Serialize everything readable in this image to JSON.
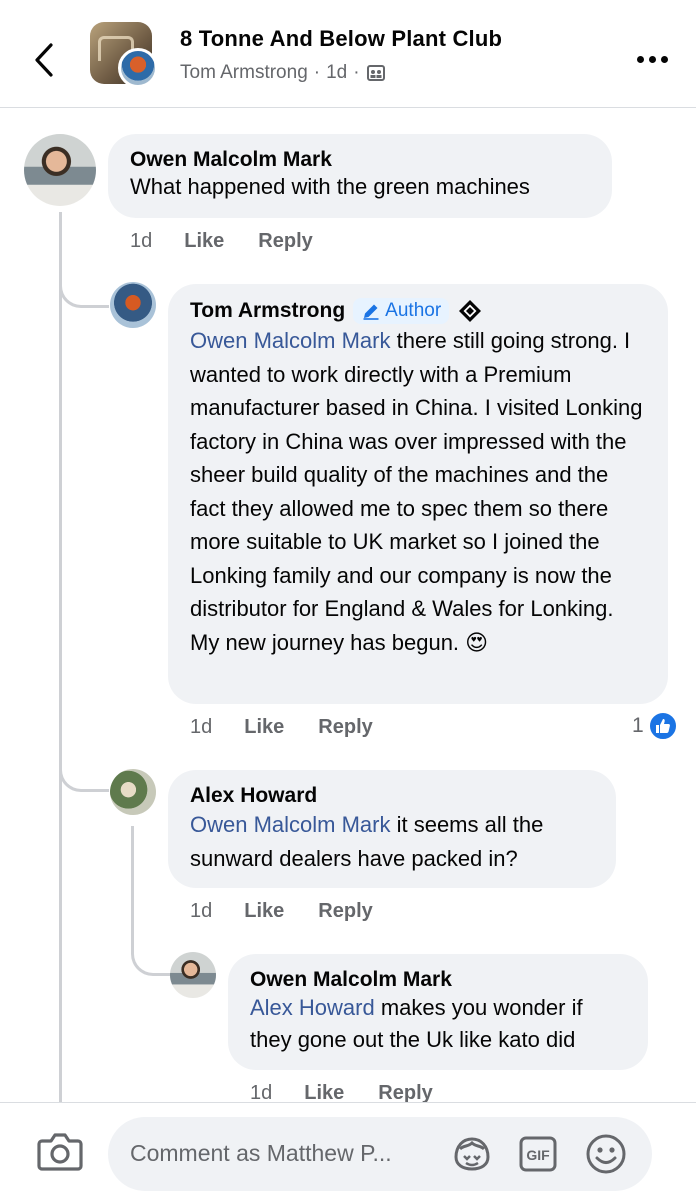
{
  "header": {
    "title": "8 Tonne And Below Plant Club",
    "author": "Tom Armstrong",
    "separator": "·",
    "time": "1d",
    "separator2": "·"
  },
  "comments": [
    {
      "name": "Owen Malcolm Mark",
      "text": "What happened with the green machines",
      "time": "1d",
      "like": "Like",
      "reply": "Reply"
    },
    {
      "name": "Tom Armstrong",
      "badge": "Author",
      "mention": "Owen Malcolm Mark",
      "text": " there still going strong. I wanted to work directly with a Premium manufacturer based in China. I visited Lonking factory in China was over impressed with the sheer build quality of the machines and the fact they allowed me to spec them so there more suitable to UK market so I joined the Lonking family and our company is now the distributor for England & Wales for Lonking. My new journey has begun. ",
      "emoji": "😍",
      "time": "1d",
      "like": "Like",
      "reply": "Reply",
      "reaction_count": "1"
    },
    {
      "name": "Alex Howard",
      "mention": "Owen Malcolm Mark",
      "text": " it seems all the sunward dealers have packed in?",
      "time": "1d",
      "like": "Like",
      "reply": "Reply"
    },
    {
      "name": "Owen Malcolm Mark",
      "mention": "Alex Howard",
      "text": " makes you wonder if they gone out the Uk like kato did",
      "time": "1d",
      "like": "Like",
      "reply": "Reply"
    }
  ],
  "composer": {
    "placeholder": "Comment as Matthew P..."
  },
  "icons": {
    "back": "chevron-left-icon",
    "more": "more-dots-icon",
    "privacy": "group-privacy-icon",
    "top_fan": "top-fan-icon",
    "like_reaction": "like-thumb-icon",
    "camera": "camera-icon",
    "avatar_sticker": "avatar-sticker-icon",
    "gif": "gif-icon",
    "emoji": "emoji-icon"
  },
  "colors": {
    "mention": "#385898",
    "author_badge": "#1b74e4",
    "bubble": "#f0f2f5"
  }
}
